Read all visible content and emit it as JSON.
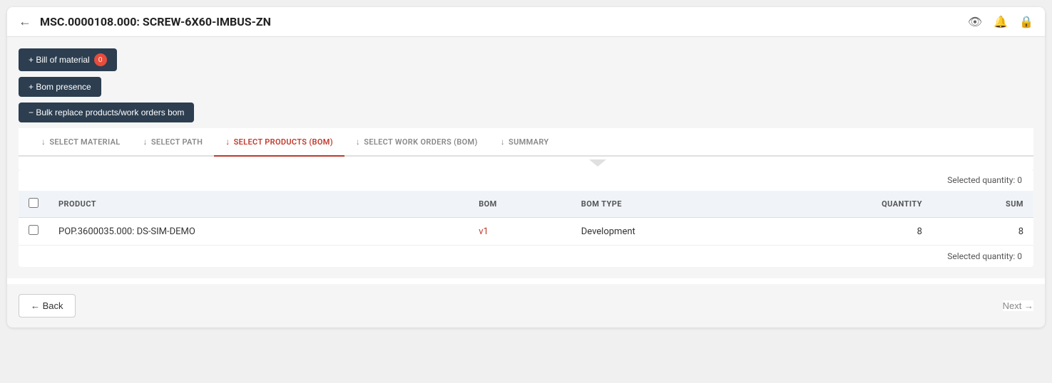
{
  "header": {
    "title": "MSC.0000108.000: SCREW-6X60-IMBUS-ZN",
    "back_label": "←",
    "icons": [
      "eye",
      "bell",
      "lock"
    ]
  },
  "buttons": {
    "bill_of_material": "+ Bill of material",
    "bill_badge": "0",
    "bom_presence": "+ Bom presence",
    "bulk_replace": "− Bulk replace products/work orders bom"
  },
  "steps": [
    {
      "label": "SELECT MATERIAL",
      "icon": "↓",
      "active": false
    },
    {
      "label": "SELECT PATH",
      "icon": "↓",
      "active": false
    },
    {
      "label": "SELECT PRODUCTS (BOM)",
      "icon": "↓",
      "active": true
    },
    {
      "label": "SELECT WORK ORDERS (BOM)",
      "icon": "↓",
      "active": false
    },
    {
      "label": "SUMMARY",
      "icon": "↓",
      "active": false
    }
  ],
  "table": {
    "selected_qty_top": "Selected quantity: 0",
    "selected_qty_bottom": "Selected quantity: 0",
    "columns": [
      "PRODUCT",
      "BOM",
      "BOM TYPE",
      "QUANTITY",
      "SUM"
    ],
    "rows": [
      {
        "product": "POP.3600035.000: DS-SIM-DEMO",
        "bom": "v1",
        "bom_type": "Development",
        "quantity": "8",
        "sum": "8"
      }
    ]
  },
  "footer": {
    "back_label": "← Back",
    "next_label": "Next →"
  }
}
